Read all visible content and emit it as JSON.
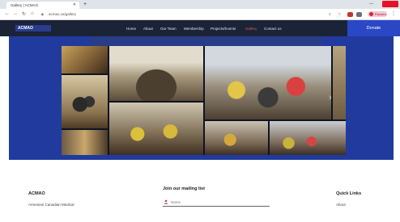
{
  "browser": {
    "tab_title": "Gallery | ACMAO",
    "tab_close": "✕",
    "new_tab": "+",
    "url": "acmao.ca/gallery",
    "profile_label": "Paused",
    "back": "←",
    "forward": "→",
    "reload": "↻",
    "home": "⌂",
    "menu": "⋮",
    "minimize": "—"
  },
  "site": {
    "logo": "ACMAO",
    "nav": [
      "Home",
      "About",
      "Our Team",
      "Membership",
      "Projects/Events",
      "Gallery",
      "Contact us"
    ],
    "active_nav": "Gallery",
    "donate": "Donate",
    "carousel_next": "›"
  },
  "footer": {
    "org_title": "ACMAO",
    "org_sub": "Armenian Canadian Medical",
    "mailing_title": "Join our mailing list",
    "name_placeholder": "Name",
    "links_title": "Quick Links",
    "links_first": "About"
  },
  "colors": {
    "header": "#1b2337",
    "hero": "#213a9e",
    "donate": "#2a47c6",
    "active_nav": "#e05757"
  }
}
